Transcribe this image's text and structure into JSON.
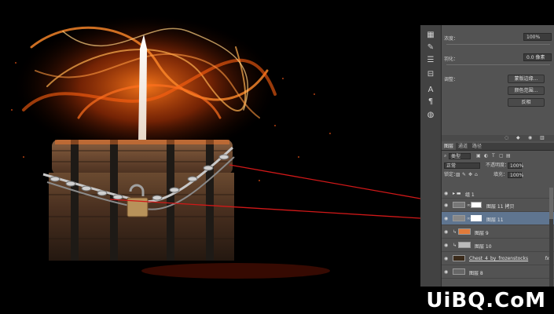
{
  "watermark": "UiBQ.CoM",
  "properties": {
    "density_label": "浓度：",
    "density_value": "100%",
    "feather_label": "羽化：",
    "feather_value": "0.0 像素",
    "adjust_label": "调整：",
    "buttons": [
      "蒙版边缘...",
      "颜色范围...",
      "反相"
    ]
  },
  "layers_panel": {
    "tabs": [
      "图层",
      "通道",
      "路径"
    ],
    "filter": "类型",
    "blend_mode": "正常",
    "opacity_label": "不透明度：",
    "opacity_value": "100%",
    "lock_label": "锁定：",
    "fill_label": "填充：",
    "fill_value": "100%",
    "layers": [
      {
        "name": "组 1",
        "type": "group",
        "selected": false,
        "fx": ""
      },
      {
        "name": "图层 11 拷贝",
        "type": "masked",
        "selected": false,
        "fx": ""
      },
      {
        "name": "图层 11",
        "type": "masked",
        "selected": true,
        "fx": ""
      },
      {
        "name": "图层 9",
        "type": "clipped-orange",
        "selected": false,
        "fx": ""
      },
      {
        "name": "图层 10",
        "type": "clipped",
        "selected": false,
        "fx": ""
      },
      {
        "name": "Chest_4_by_frozenstocks",
        "type": "image",
        "selected": false,
        "fx": "fx"
      },
      {
        "name": "图层 8",
        "type": "image",
        "selected": false,
        "fx": ""
      }
    ]
  },
  "colors": {
    "panel_bg": "#535353",
    "selected_row": "#5f7590",
    "callout_line": "#d01818"
  }
}
